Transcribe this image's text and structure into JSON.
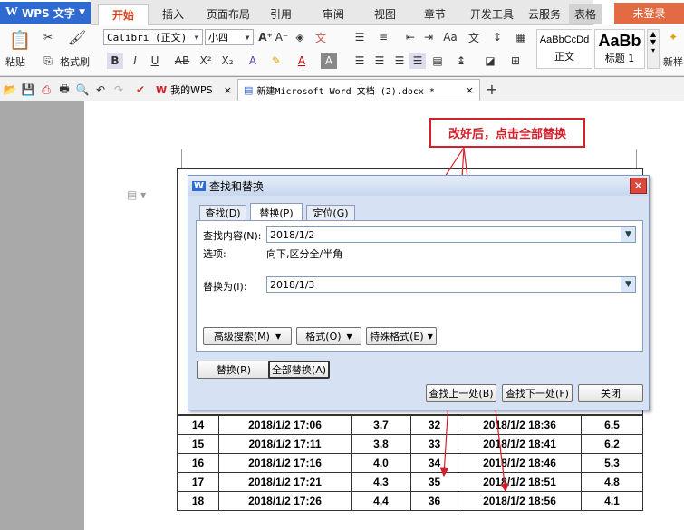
{
  "app": {
    "name": "WPS 文字",
    "login": "未登录"
  },
  "menu_tabs": [
    "开始",
    "插入",
    "页面布局",
    "引用",
    "审阅",
    "视图",
    "章节",
    "开发工具",
    "云服务",
    "表格"
  ],
  "ribbon": {
    "paste": "粘贴",
    "format_painter": "格式刷",
    "font_name": "Calibri (正文)",
    "font_size": "小四",
    "styles": [
      {
        "preview": "AaBbCcDd",
        "name": "正文"
      },
      {
        "preview": "AaBb",
        "name": "标题 1"
      }
    ],
    "new_style": "新样"
  },
  "doc_tabs": [
    {
      "label": "我的WPS"
    },
    {
      "label": "新建Microsoft Word 文档 (2).docx *"
    }
  ],
  "dialog": {
    "title": "查找和替换",
    "tabs": [
      "查找(D)",
      "替换(P)",
      "定位(G)"
    ],
    "find_label": "查找内容(N):",
    "find_value": "2018/1/2",
    "options_label": "选项:",
    "options_value": "向下,区分全/半角",
    "replace_label": "替换为(I):",
    "replace_value": "2018/1/3",
    "advanced_search": "高级搜索(M)",
    "format": "格式(O)",
    "special_format": "特殊格式(E)",
    "replace_btn": "替换(R)",
    "replace_all_btn": "全部替换(A)",
    "find_prev": "查找上一处(B)",
    "find_next": "查找下一处(F)",
    "close": "关闭"
  },
  "callout": "改好后，点击全部替换",
  "table_rows": [
    [
      "14",
      "2018/1/2 17:06",
      "3.7",
      "32",
      "2018/1/2 18:36",
      "6.5"
    ],
    [
      "15",
      "2018/1/2 17:11",
      "3.8",
      "33",
      "2018/1/2 18:41",
      "6.2"
    ],
    [
      "16",
      "2018/1/2 17:16",
      "4.0",
      "34",
      "2018/1/2 18:46",
      "5.3"
    ],
    [
      "17",
      "2018/1/2 17:21",
      "4.3",
      "35",
      "2018/1/2 18:51",
      "4.8"
    ],
    [
      "18",
      "2018/1/2 17:26",
      "4.4",
      "36",
      "2018/1/2 18:56",
      "4.1"
    ]
  ],
  "colors": {
    "accent_red": "#d5202a",
    "title_blue": "#2e6ad1",
    "login_orange": "#e36b43"
  }
}
